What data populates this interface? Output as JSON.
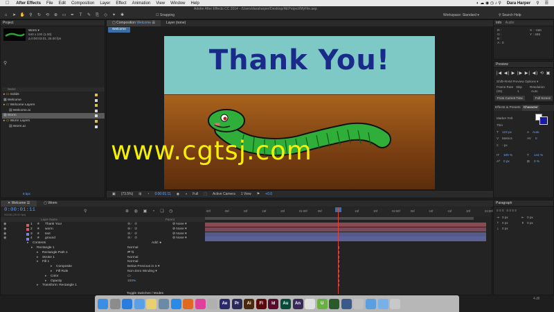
{
  "menubar": {
    "app": "After Effects",
    "items": [
      "File",
      "Edit",
      "Composition",
      "Layer",
      "Effect",
      "Animation",
      "View",
      "Window",
      "Help"
    ],
    "user": "Dara Harper"
  },
  "toolbar": {
    "doc_path": "Adobe After Effects CC 2014 - /Users/daraharper/Desktop/AEProject/MyFile.aep",
    "snapping": "Snapping",
    "workspace_label": "Workspace:",
    "workspace_value": "Standard",
    "search_help": "Search Help"
  },
  "project": {
    "tab": "Project",
    "selected_name": "Worm ▾",
    "selected_info": [
      "640 x 100 (1.00)",
      "Δ 0:00:03:01, 25.00 fps"
    ],
    "column_name": "Name",
    "items": [
      {
        "name": "Solids",
        "indent": 0,
        "type": "folder",
        "color": "#e0c040"
      },
      {
        "name": "Welcome",
        "indent": 0,
        "type": "comp",
        "color": "#d8d8d8"
      },
      {
        "name": "Welcome Layers",
        "indent": 0,
        "type": "folder",
        "color": "#e0c040"
      },
      {
        "name": "Welcome.ai",
        "indent": 1,
        "type": "file",
        "color": "#d8d8d8"
      },
      {
        "name": "Worm",
        "indent": 0,
        "type": "comp",
        "color": "#d8d8d8",
        "selected": true
      },
      {
        "name": "Worm Layers",
        "indent": 0,
        "type": "folder",
        "color": "#e0c040"
      },
      {
        "name": "Worm.ai",
        "indent": 1,
        "type": "file",
        "color": "#d8d8d8"
      }
    ],
    "bpc": "8 bpc"
  },
  "composition": {
    "tab": "Composition",
    "tab_name": "Welcome",
    "layer_tab": "Layer (none)",
    "subtab": "Welcome",
    "title_text": "Thank You!",
    "watermark": "www.cgtsj.com",
    "zoom": "(73.5%)",
    "timecode": "0:00:01:11",
    "resolution": "Full",
    "camera": "Active Camera",
    "views": "1 View",
    "exposure": "+0.0"
  },
  "info": {
    "tab": "Info",
    "audio_tab": "Audio",
    "r": "R :",
    "g": "G :",
    "b": "B :",
    "a": "A : 0",
    "x": "X : -150",
    "y": "Y : 485"
  },
  "preview": {
    "tab": "Preview",
    "controls": "|◀ ◀| ▶ |▶ ▶| ◀) ⟲ ▣",
    "shift_ram": "Shift+RAM Preview Options ▾",
    "frame_rate_label": "Frame Rate",
    "skip_label": "Skip",
    "resolution_label": "Resolution",
    "frame_rate": "(25)",
    "skip": "1",
    "resolution": "Auto",
    "from_current": "From Current Time",
    "full_screen": "Full Screen"
  },
  "character": {
    "tabs": [
      "Effects & Presets",
      "Character"
    ],
    "font": "Marker Felt",
    "style": "Thin",
    "size": "123 px",
    "leading": "Auto",
    "kerning": "Metrics",
    "tracking": "0",
    "stroke": "- px",
    "vscale": "100 %",
    "hscale": "144 %",
    "baseline": "0 px",
    "tsume": "0 %",
    "fill_color": "#1a1aa0"
  },
  "paragraph": {
    "tab": "Paragraph",
    "indent_left": "0 px",
    "indent_right": "0 px",
    "space_before": "0 px",
    "first_line": "0 px",
    "space_after": "0 px"
  },
  "timeline": {
    "tabs": [
      "Welcome",
      "Worm"
    ],
    "timecode": "0:00:01:11",
    "timecode_sub": "00036 (25.00 fps)",
    "col_layer": "Layer Name",
    "col_parent": "Parent",
    "ruler": [
      "00f",
      "05f",
      "10f",
      "15f",
      "20f",
      "01:00f",
      "05f",
      "10f",
      "15f",
      "20f",
      "02:00f",
      "05f",
      "10f",
      "15f",
      "20f",
      "03:00f"
    ],
    "layers": [
      {
        "num": "1",
        "name": "Thank You!",
        "color": "#d06060",
        "parent": "None",
        "bar": "#8a4a52"
      },
      {
        "num": "2",
        "name": "worm",
        "color": "#d06060",
        "parent": "None",
        "bar": "#7b4a5a"
      },
      {
        "num": "3",
        "name": "text",
        "color": "#7a86d8",
        "parent": "None",
        "bar": "#555a8a"
      },
      {
        "num": "4",
        "name": "ground",
        "color": "#7a86d8",
        "parent": "None",
        "bar": "#5a6098"
      }
    ],
    "props": [
      {
        "name": "Contents",
        "indent": 46,
        "value": "",
        "add": "Add: ●"
      },
      {
        "name": "Rectangle 1",
        "indent": 52,
        "value": "Normal"
      },
      {
        "name": "Rectangle Path 1",
        "indent": 60,
        "value": "⇄ ⇅"
      },
      {
        "name": "Stroke 1",
        "indent": 60,
        "value": "Normal"
      },
      {
        "name": "Fill 1",
        "indent": 60,
        "value": "Normal"
      },
      {
        "name": "Composite",
        "indent": 80,
        "value": "Below Previous in S ▾"
      },
      {
        "name": "Fill Rule",
        "indent": 80,
        "value": "Non-Zero Winding ▾"
      },
      {
        "name": "Color",
        "indent": 72,
        "value": "▭"
      },
      {
        "name": "Opacity",
        "indent": 72,
        "value": "100%"
      },
      {
        "name": "Transform: Rectangle 1",
        "indent": 60,
        "value": ""
      }
    ],
    "toggle": "Toggle Switches / Modes"
  },
  "dock": [
    {
      "name": "finder",
      "color": "#3a8ee6",
      "glyph": ""
    },
    {
      "name": "launchpad",
      "color": "#8c8c8c",
      "glyph": ""
    },
    {
      "name": "safari",
      "color": "#2a7de0",
      "glyph": ""
    },
    {
      "name": "mail",
      "color": "#5aa0e8",
      "glyph": ""
    },
    {
      "name": "notes",
      "color": "#e8d070",
      "glyph": ""
    },
    {
      "name": "preview",
      "color": "#6a8aa8",
      "glyph": ""
    },
    {
      "name": "app-store",
      "color": "#2a8ae8",
      "glyph": ""
    },
    {
      "name": "firefox",
      "color": "#e06a20",
      "glyph": ""
    },
    {
      "name": "itunes",
      "color": "#e0409a",
      "glyph": ""
    },
    {
      "name": "photos",
      "color": "#b0b0b0",
      "glyph": ""
    },
    {
      "name": "after-effects",
      "color": "#2a2a6a",
      "glyph": "Ae"
    },
    {
      "name": "premiere",
      "color": "#2a2a5a",
      "glyph": "Pr"
    },
    {
      "name": "illustrator",
      "color": "#4a2a0a",
      "glyph": "Ai"
    },
    {
      "name": "flash",
      "color": "#5a0a0a",
      "glyph": "Fl"
    },
    {
      "name": "indesign",
      "color": "#5a0a2a",
      "glyph": "Id"
    },
    {
      "name": "audition",
      "color": "#0a4a3a",
      "glyph": "Au"
    },
    {
      "name": "animate",
      "color": "#3a2a5a",
      "glyph": "An"
    },
    {
      "name": "chrome",
      "color": "#e0e0e0",
      "glyph": ""
    },
    {
      "name": "upwork",
      "color": "#6ab040",
      "glyph": "U"
    },
    {
      "name": "dreamweaver",
      "color": "#2a5a2a",
      "glyph": ""
    },
    {
      "name": "quicktime",
      "color": "#3a5a8a",
      "glyph": ""
    },
    {
      "name": "documents",
      "color": "#c0c0c0",
      "glyph": ""
    },
    {
      "name": "downloads",
      "color": "#5aa0e0",
      "glyph": ""
    },
    {
      "name": "folder",
      "color": "#7ab0e8",
      "glyph": ""
    },
    {
      "name": "trash",
      "color": "#c8c8c8",
      "glyph": ""
    }
  ],
  "version": "4.dll"
}
